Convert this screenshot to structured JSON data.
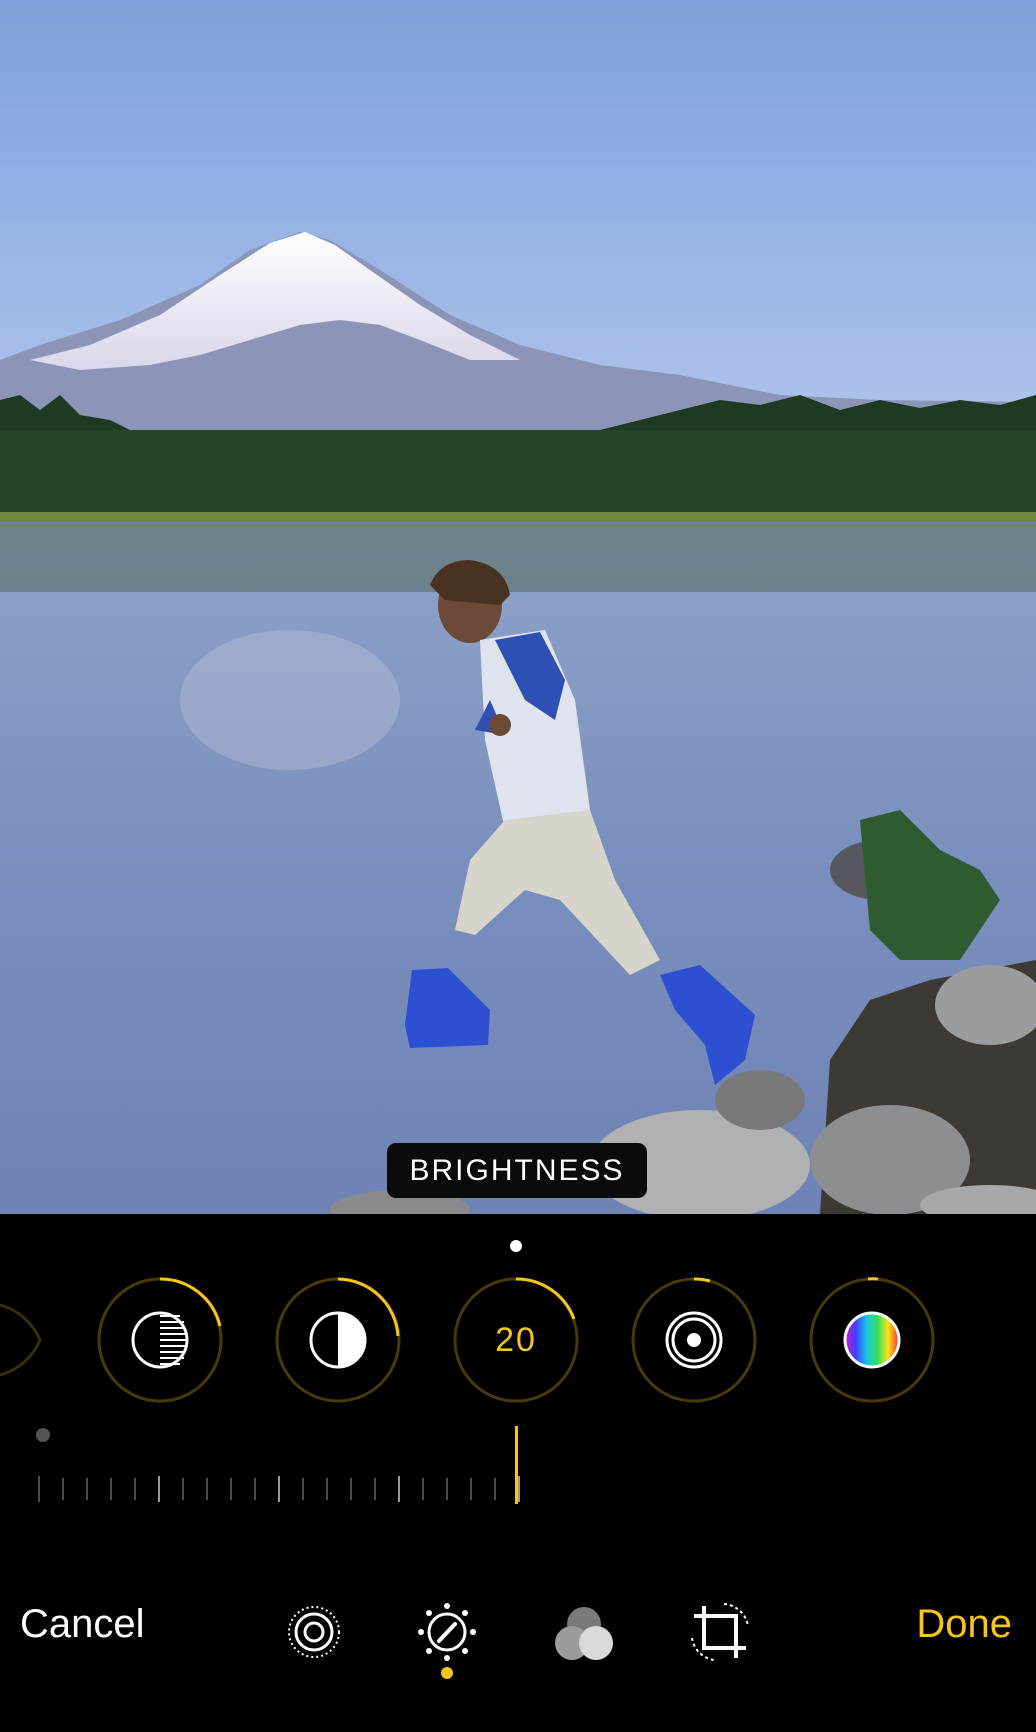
{
  "editor": {
    "tool_label": "BRIGHTNESS",
    "active_value": "20",
    "cancel_label": "Cancel",
    "done_label": "Done"
  },
  "adjustments": [
    {
      "icon": "exposure-icon",
      "level": 0.3
    },
    {
      "icon": "contrast-icon",
      "level": 0.3
    },
    {
      "icon": "brightness-icon",
      "level": 0.2
    },
    {
      "icon": "vignette-icon",
      "level": 0.05
    },
    {
      "icon": "saturation-icon",
      "level": 0.02
    }
  ],
  "bottom_tools": [
    "live-icon",
    "adjust-icon",
    "filters-icon",
    "crop-icon"
  ],
  "colors": {
    "accent": "#f8c51a",
    "background": "#000000"
  }
}
